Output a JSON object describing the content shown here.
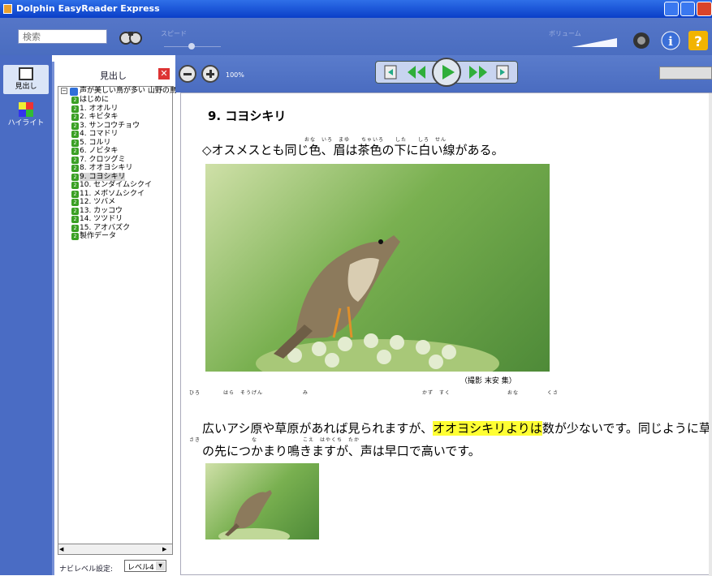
{
  "window": {
    "title": "Dolphin EasyReader Express"
  },
  "toolbar": {
    "search_placeholder": "検索",
    "speed_label": "スピード",
    "volume_label": "ボリューム"
  },
  "sidebar": {
    "tabs": [
      {
        "label": "見出し"
      },
      {
        "label": "ハイライト"
      }
    ]
  },
  "panel": {
    "title": "見出し",
    "root": "声が美しい鳥が多い 山野の鳥",
    "items": [
      "はじめに",
      "1. オオルリ",
      "2. キビタキ",
      "3. サンコウチョウ",
      "4. コマドリ",
      "5. コルリ",
      "6. ノビタキ",
      "7. クロツグミ",
      "8. オオヨシキリ",
      "9. コヨシキリ",
      "10. センダイムシクイ",
      "11. メボソムシクイ",
      "12. ツバメ",
      "13. カッコウ",
      "14. ツツドリ",
      "15. アオバズク",
      "製作データ"
    ],
    "selected_index": 9,
    "nav_level_label": "ナビレベル設定:",
    "nav_level_value": "レベル4"
  },
  "viewer": {
    "zoom": "100%"
  },
  "content": {
    "heading": "9. コヨシキリ",
    "line1": "◇オスメスとも同じ色、眉は茶色の下に白い線がある。",
    "ruby1": "おな　いろ　まゆ　　ちゃいろ　　した　　しろ　せん",
    "caption": "（撮影 末安 集）",
    "ruby2": "ひろ　　　　はら　そうげん　　　　　　　み　　　　　　　　　　　　　　　　　　　　かず　すく　　　　　　　　　　おな　　　　　くさ",
    "para_part1": "広いアシ原や草原があれば見られますが、",
    "para_highlight": "オオヨシキリよりは",
    "para_part2": "数が少ないです。同じように草",
    "ruby3": "さき　　　　　　　　　な　　　　　　　　こえ　はやくち　たか",
    "para_line2": "の先につかまり鳴きますが、声は早口で高いです。"
  },
  "colors": {
    "titlebar": "#0a3fc8",
    "highlight": "#ffff33",
    "tree_icon": "#3aa024"
  }
}
